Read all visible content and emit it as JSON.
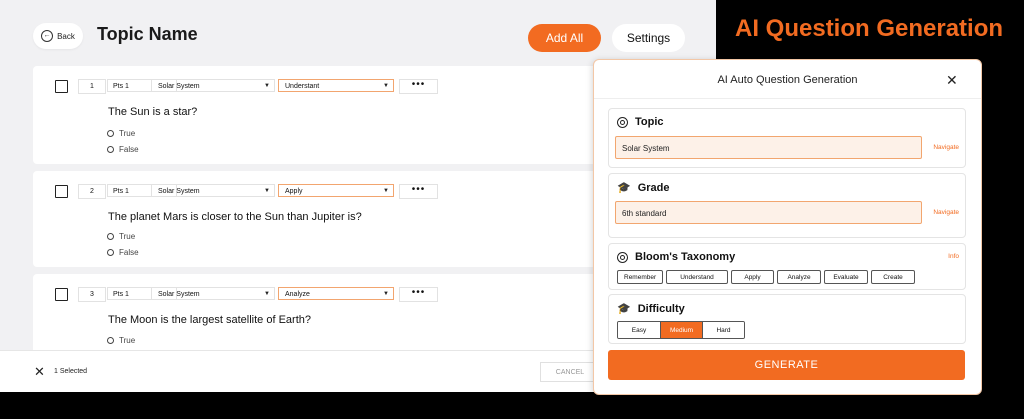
{
  "header": {
    "back_label": "Back",
    "title": "Topic Name",
    "add_all_label": "Add All",
    "settings_label": "Settings"
  },
  "questions": [
    {
      "number": "1",
      "points": "Pts 1",
      "subject": "Solar System",
      "bloom": "Understant",
      "text": "The Sun is a star?",
      "options": [
        "True",
        "False"
      ]
    },
    {
      "number": "2",
      "points": "Pts 1",
      "subject": "Solar System",
      "bloom": "Apply",
      "text": "The planet Mars is closer to the Sun than Jupiter is?",
      "options": [
        "True",
        "False"
      ]
    },
    {
      "number": "3",
      "points": "Pts 1",
      "subject": "Solar System",
      "bloom": "Analyze",
      "text": "The Moon is the largest satellite of Earth?",
      "options": [
        "True"
      ]
    }
  ],
  "footer": {
    "selected_label": "1 Selected",
    "cancel_label": "CANCEL"
  },
  "headline": "AI Question Generation",
  "dialog": {
    "title": "AI Auto Question Generation",
    "topic": {
      "label": "Topic",
      "value": "Solar System",
      "link": "Navigate"
    },
    "grade": {
      "label": "Grade",
      "value": "6th standard",
      "link": "Navigate"
    },
    "bloom": {
      "label": "Bloom's Taxonomy",
      "link": "Info",
      "options": [
        "Remember",
        "Understand",
        "Apply",
        "Analyze",
        "Evaluate",
        "Create"
      ]
    },
    "difficulty": {
      "label": "Difficulty",
      "options": [
        "Easy",
        "Medium",
        "Hard"
      ],
      "selected": "Medium"
    },
    "generate_label": "GENERATE"
  },
  "colors": {
    "accent": "#f26b21",
    "app_bg": "#f1f1f3",
    "page_bg": "#000000"
  },
  "icons": {
    "back": "circle-arrow-left-icon",
    "topic": "target-icon",
    "grade": "graduation-cap-icon",
    "bloom": "target-icon",
    "difficulty": "graduation-cap-icon",
    "close": "close-icon",
    "deselect": "close-icon",
    "more": "more-horizontal-icon",
    "dropdown": "chevron-down-icon"
  }
}
